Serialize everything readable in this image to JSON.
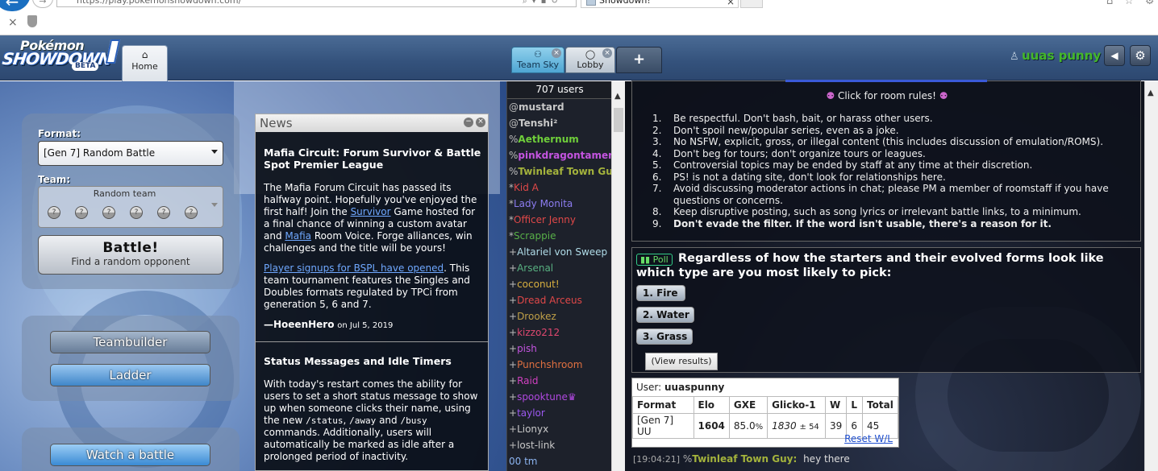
{
  "browser": {
    "url": "https://play.pokemonshowdown.com/",
    "tab_title": "Showdown!",
    "back_glyph": "←",
    "fwd_glyph": "→",
    "stop_glyph": "×"
  },
  "header": {
    "logo_line1": "Pokémon",
    "logo_line2": "SHOWDOWN",
    "logo_badge": "BETA",
    "home_tab": "Home",
    "room_tabs": [
      {
        "label": "Team Sky",
        "active": true
      },
      {
        "label": "Lobby",
        "active": false
      }
    ],
    "new_tab": "+",
    "username": "uuas punny"
  },
  "mainmenu": {
    "format_label": "Format:",
    "format_value": "[Gen 7] Random Battle",
    "team_label": "Team:",
    "team_value": "Random team",
    "battle_label": "Battle!",
    "battle_sub": "Find a random opponent",
    "teambuilder": "Teambuilder",
    "ladder": "Ladder",
    "watch": "Watch a battle"
  },
  "news": {
    "title": "News",
    "item1": {
      "title": "Mafia Circuit: Forum Survivor & Battle Spot Premier League",
      "p1_a": "The Mafia Forum Circuit has passed its halfway point. Hopefully you've enjoyed the first half! Join the ",
      "p1_link1": "Survivor",
      "p1_b": " Game hosted for a final chance of winning a custom avatar and ",
      "p1_link2": "Mafia",
      "p1_c": " Room Voice. Forge alliances, win challenges and the title will be yours!",
      "p2_link": "Player signups for BSPL have opened",
      "p2_b": ". This team tournament features the Singles and Doubles formats regulated by TPCi from generation 5, 6 and 7.",
      "sig_author": "—HoeenHero",
      "sig_date": "on Jul 5, 2019"
    },
    "item2": {
      "title": "Status Messages and Idle Timers",
      "p1_a": "With today's restart comes the ability for users to set a short status message to show up when someone clicks their name, using the new ",
      "cmd1": "/status",
      "sep1": ", ",
      "cmd2": "/away",
      "sep2": " and ",
      "cmd3": "/busy",
      "p1_b": " commands. Additionally, users will automatically be marked as idle after a prolonged period of inactivity."
    }
  },
  "userlist": {
    "count": "707 users",
    "users": [
      {
        "g": "@",
        "name": "mustard",
        "color": "#c8c8c8"
      },
      {
        "g": "@",
        "name": "Tenshi²",
        "color": "#c8c8c8"
      },
      {
        "g": "%",
        "name": "Aethernum",
        "color": "#6fcf3a"
      },
      {
        "g": "%",
        "name": "pinkdragontamer",
        "color": "#c454e0"
      },
      {
        "g": "%",
        "name": "Twinleaf Town Guy",
        "color": "#a4b33c"
      },
      {
        "g": "*",
        "name": "Kid A",
        "color": "#e04848"
      },
      {
        "g": "*",
        "name": "Lady Monita",
        "color": "#8c7cf0"
      },
      {
        "g": "*",
        "name": "Officer Jenny",
        "color": "#e04848"
      },
      {
        "g": "*",
        "name": "Scrappie",
        "color": "#58b048"
      },
      {
        "g": "+",
        "name": "Altariel von Sweep",
        "color": "#b0dce8"
      },
      {
        "g": "+",
        "name": "Arsenal",
        "color": "#58b080"
      },
      {
        "g": "+",
        "name": "coconut!",
        "color": "#d8b040"
      },
      {
        "g": "+",
        "name": "Dread Arceus",
        "color": "#e04848"
      },
      {
        "g": "+",
        "name": "Drookez",
        "color": "#c0a048"
      },
      {
        "g": "+",
        "name": "kizzo212",
        "color": "#e04870"
      },
      {
        "g": "+",
        "name": "pish",
        "color": "#c454e0"
      },
      {
        "g": "+",
        "name": "Punchshroom",
        "color": "#e07040"
      },
      {
        "g": "+",
        "name": "Raid",
        "color": "#d040c0"
      },
      {
        "g": "+",
        "name": "spooktune♛",
        "color": "#b048e0"
      },
      {
        "g": "+",
        "name": "taylor",
        "color": "#9c58f0"
      },
      {
        "g": "+",
        "name": "Lionyx",
        "color": "#c8c8c8"
      },
      {
        "g": "+",
        "name": "lost-link",
        "color": "#c8c8c8"
      },
      {
        "g": " ",
        "name": "00 tm",
        "color": "#8cb4f0"
      }
    ]
  },
  "chat": {
    "rules_title": "Click for room rules!",
    "rules_icon": "⚉",
    "rules": [
      {
        "n": "1.",
        "t": "Be respectful. Don't bash, bait, or harass other users."
      },
      {
        "n": "2.",
        "t": "Don't spoil new/popular series, even as a joke."
      },
      {
        "n": "3.",
        "t": "No NSFW, explicit, gross, or illegal content (this includes discussion of emulation/ROMS)."
      },
      {
        "n": "4.",
        "t": "Don't beg for tours; don't organize tours or leagues."
      },
      {
        "n": "5.",
        "t": "Controversial topics may be ended by staff at any time at their discretion."
      },
      {
        "n": "6.",
        "t": "PS! is not a dating site, don't look for relationships here."
      },
      {
        "n": "7.",
        "t": "Avoid discussing moderator actions in chat; please PM a member of roomstaff if you have questions or concerns."
      },
      {
        "n": "8.",
        "t": "Keep disruptive posting, such as song lyrics or irrelevant battle links, to a minimum."
      },
      {
        "n": "9.",
        "t": "Don't evade the filter. If the word isn't usable, there's a reason for it."
      }
    ],
    "poll_tag": "Poll",
    "poll_question": "Regardless of how the starters and their evolved forms look like which type are you most likely to pick:",
    "poll_options": [
      "1. Fire",
      "2. Water",
      "3. Grass"
    ],
    "view_results": "(View results)",
    "rating": {
      "user_label": "User:",
      "user": "uuaspunny",
      "headers": [
        "Format",
        "Elo",
        "GXE",
        "Glicko-1",
        "W",
        "L",
        "Total"
      ],
      "row": {
        "format": "[Gen 7] UU",
        "elo": "1604",
        "gxe": "85.0",
        "gxe_unit": "%",
        "glicko": "1830",
        "glicko_dev": "± 54",
        "w": "39",
        "l": "6",
        "total": "45"
      },
      "reset": "Reset W/L"
    },
    "message": {
      "time": "[19:04:21]",
      "group": "%",
      "user": "Twinleaf Town Guy:",
      "text": "hey there"
    }
  }
}
